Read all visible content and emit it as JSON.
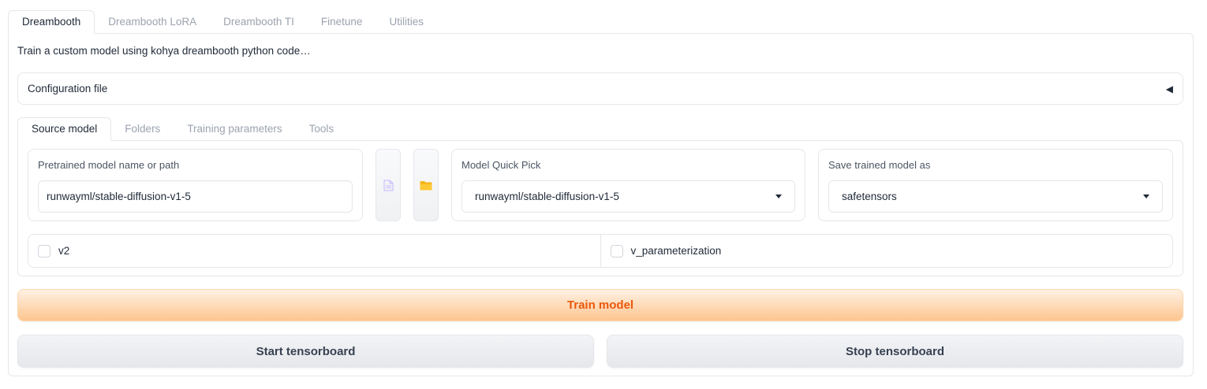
{
  "top_tabs": [
    "Dreambooth",
    "Dreambooth LoRA",
    "Dreambooth TI",
    "Finetune",
    "Utilities"
  ],
  "description": "Train a custom model using kohya dreambooth python code…",
  "config_accordion": {
    "label": "Configuration file",
    "arrow": "◀"
  },
  "sub_tabs": [
    "Source model",
    "Folders",
    "Training parameters",
    "Tools"
  ],
  "source_model": {
    "pretrained": {
      "label": "Pretrained model name or path",
      "value": "runwayml/stable-diffusion-v1-5"
    },
    "quick_pick": {
      "label": "Model Quick Pick",
      "value": "runwayml/stable-diffusion-v1-5"
    },
    "save_as": {
      "label": "Save trained model as",
      "value": "safetensors"
    },
    "file_icon": "document-icon",
    "folder_icon": "folder-icon"
  },
  "checkboxes": {
    "v2": "v2",
    "v_param": "v_parameterization"
  },
  "buttons": {
    "train": "Train model",
    "start_tb": "Start tensorboard",
    "stop_tb": "Stop tensorboard"
  },
  "colors": {
    "accent": "#ea580c",
    "train_bg": "#fdc58f",
    "folder": "#f5b71d"
  }
}
